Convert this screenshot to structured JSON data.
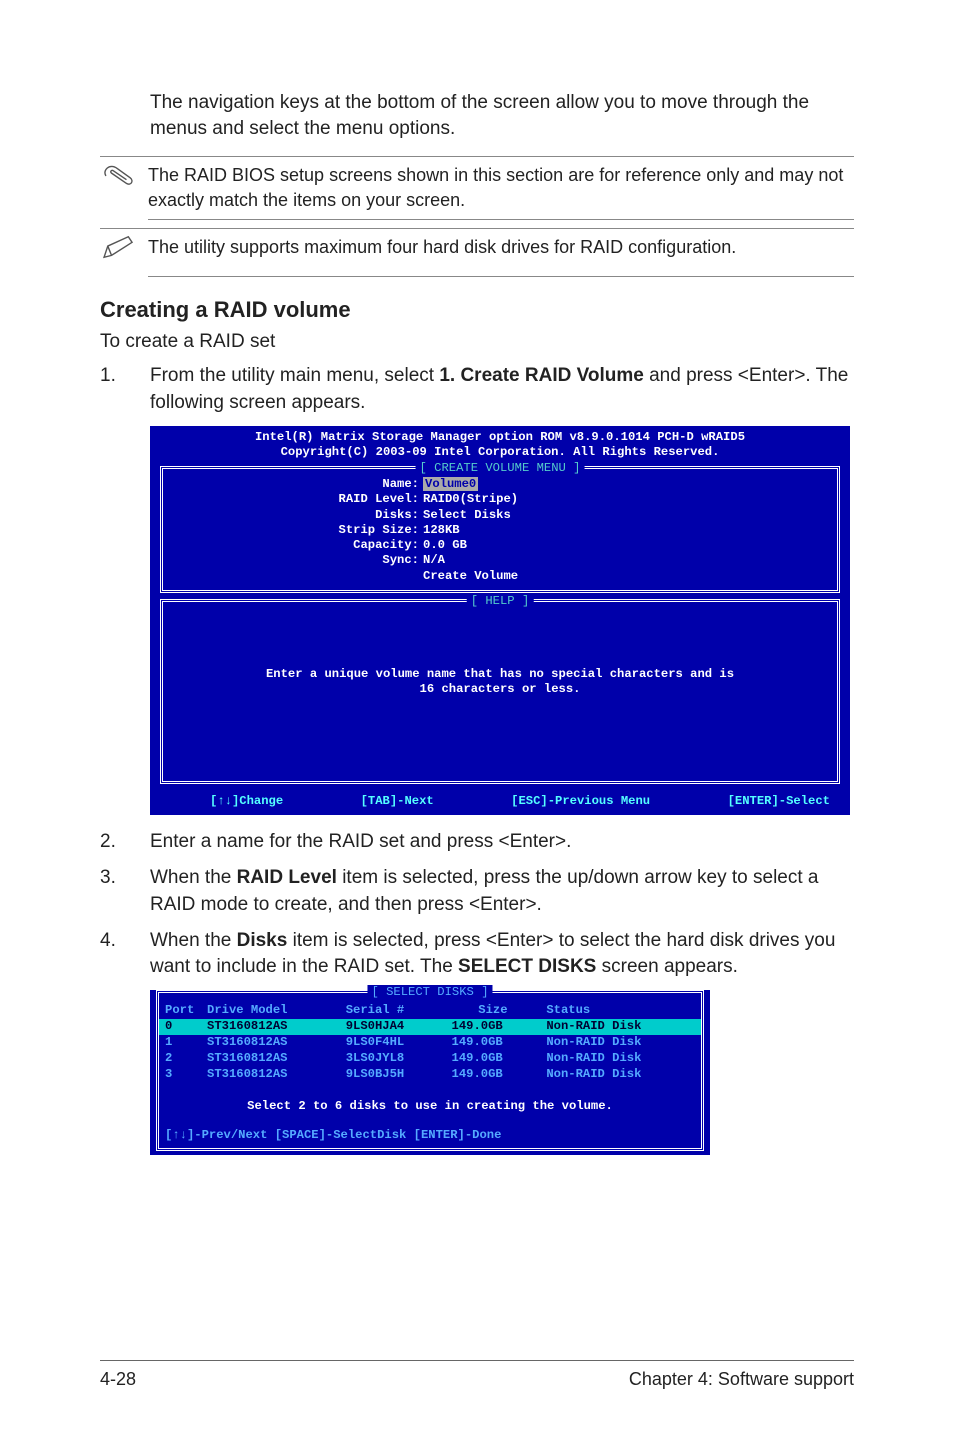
{
  "intro": "The navigation keys at the bottom of the screen allow you to move through the menus and select the menu options.",
  "note1": "The RAID BIOS setup screens shown in this section are for reference only and may not exactly match the items on your screen.",
  "note2": "The utility supports maximum four hard disk drives for RAID configuration.",
  "heading": "Creating a RAID volume",
  "subline": "To create a RAID set",
  "step1_a": "From the utility main menu, select ",
  "step1_b": "1. Create RAID Volume",
  "step1_c": " and press <Enter>. The following screen appears.",
  "step2": "Enter a name for the RAID set and press <Enter>.",
  "step3_a": "When the ",
  "step3_b": "RAID Level",
  "step3_c": " item is selected, press the up/down arrow key to select a RAID mode to create, and then press <Enter>.",
  "step4_a": "When the ",
  "step4_b": "Disks",
  "step4_c": " item is selected, press <Enter> to select the hard disk drives you want to include in the RAID set. The ",
  "step4_d": "SELECT DISKS",
  "step4_e": " screen appears.",
  "bios": {
    "header1": "Intel(R) Matrix Storage Manager option ROM v8.9.0.1014 PCH-D wRAID5",
    "header2": "Copyright(C) 2003-09 Intel Corporation.  All Rights Reserved.",
    "title1": "[ CREATE VOLUME MENU ]",
    "labels": {
      "name": "Name:",
      "raid_level": "RAID Level:",
      "disks": "Disks:",
      "strip": "Strip Size:",
      "capacity": "Capacity:",
      "sync": "Sync:",
      "create": ""
    },
    "values": {
      "name": "Volume0",
      "raid_level": "RAID0(Stripe)",
      "disks": "Select Disks",
      "strip": "128KB",
      "capacity": "0.0   GB",
      "sync": "N/A",
      "create": "Create Volume"
    },
    "help_title": "[ HELP ]",
    "help_line1": "Enter a unique volume name that has no special characters and is",
    "help_line2": "16 characters or less.",
    "footer": {
      "k1": "[↑↓]Change",
      "k2": "[TAB]-Next",
      "k3": "[ESC]-Previous Menu",
      "k4": "[ENTER]-Select"
    }
  },
  "disks": {
    "title": "[ SELECT DISKS ]",
    "headers": {
      "port": "Port",
      "drive": "Drive Model",
      "serial": "Serial #",
      "size": "Size",
      "status": "Status"
    },
    "rows": [
      {
        "port": "0",
        "drive": "ST3160812AS",
        "serial": "9LS0HJA4",
        "size": "149.0GB",
        "status": "Non-RAID Disk"
      },
      {
        "port": "1",
        "drive": "ST3160812AS",
        "serial": "9LS0F4HL",
        "size": "149.0GB",
        "status": "Non-RAID Disk"
      },
      {
        "port": "2",
        "drive": "ST3160812AS",
        "serial": "3LS0JYL8",
        "size": "149.0GB",
        "status": "Non-RAID Disk"
      },
      {
        "port": "3",
        "drive": "ST3160812AS",
        "serial": "9LS0BJ5H",
        "size": "149.0GB",
        "status": "Non-RAID Disk"
      }
    ],
    "help": "Select 2 to 6 disks to use in creating the volume.",
    "footer": "[↑↓]-Prev/Next [SPACE]-SelectDisk [ENTER]-Done"
  },
  "footer": {
    "left": "4-28",
    "right": "Chapter 4: Software support"
  }
}
